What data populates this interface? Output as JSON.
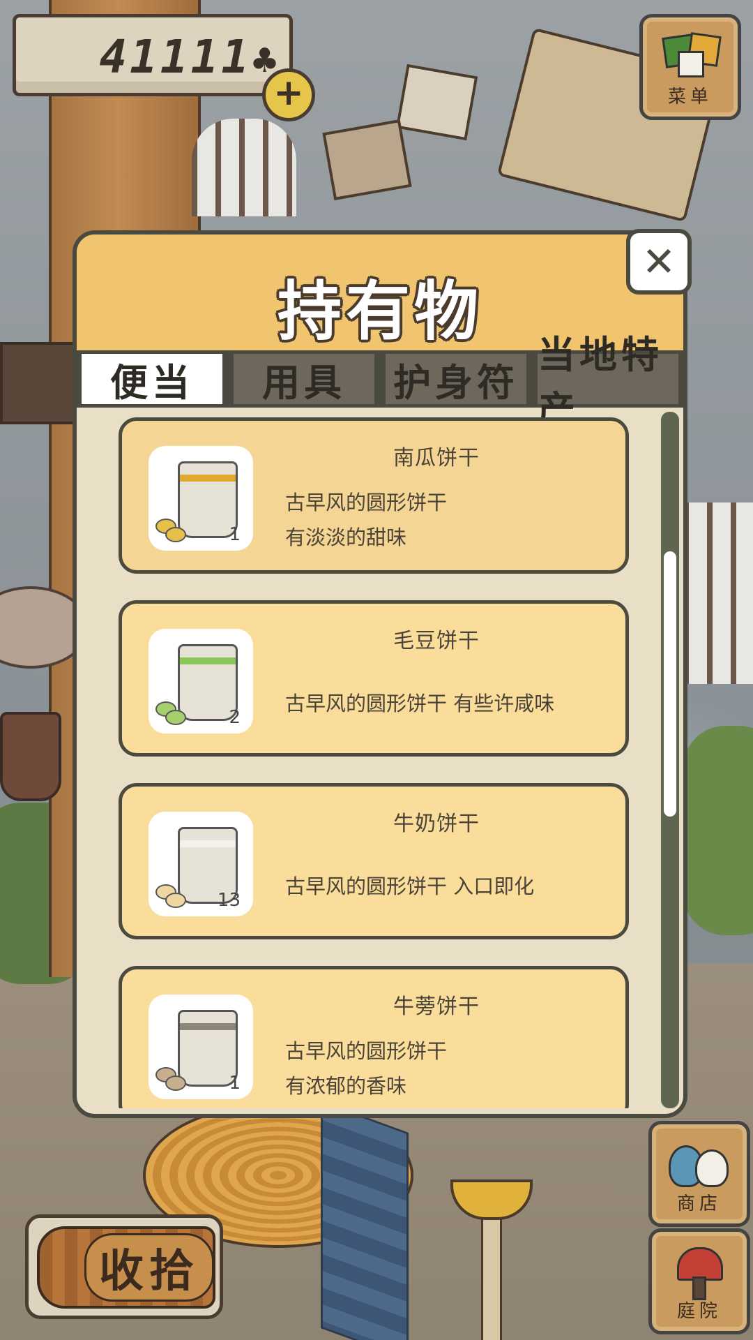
{
  "hud": {
    "clover_count": "41111",
    "add_symbol": "+",
    "menu_label": "菜单",
    "shop_label": "商店",
    "yard_label": "庭院",
    "tidy_label": "收拾"
  },
  "dialog": {
    "title": "持有物",
    "close_symbol": "✕",
    "tabs": [
      {
        "label": "便当",
        "active": true
      },
      {
        "label": "用具",
        "active": false
      },
      {
        "label": "护身符",
        "active": false
      },
      {
        "label": "当地特产",
        "active": false
      }
    ],
    "items": [
      {
        "name": "南瓜饼干",
        "desc": "古早风的圆形饼干\n有淡淡的甜味",
        "qty": "1",
        "band_color": "#e0a92e",
        "cookie_color": "#e6c14a"
      },
      {
        "name": "毛豆饼干",
        "desc": "古早风的圆形饼干  有些许咸味",
        "qty": "2",
        "band_color": "#8cc55a",
        "cookie_color": "#a8cf6e"
      },
      {
        "name": "牛奶饼干",
        "desc": "古早风的圆形饼干  入口即化",
        "qty": "13",
        "band_color": "#f4f1ea",
        "cookie_color": "#efd6a3"
      },
      {
        "name": "牛蒡饼干",
        "desc": "古早风的圆形饼干\n有浓郁的香味",
        "qty": "1",
        "band_color": "#8b857a",
        "cookie_color": "#c7ae8c"
      }
    ]
  }
}
